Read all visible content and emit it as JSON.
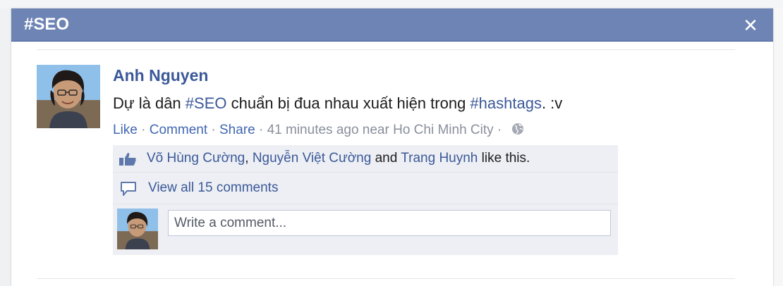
{
  "dialog": {
    "title": "#SEO",
    "close_label": "✕"
  },
  "post": {
    "author": "Anh Nguyen",
    "message": {
      "part1": "Dự là dân ",
      "hashtag1": "#SEO",
      "part2": " chuẩn bị đua nhau xuất hiện trong ",
      "hashtag2": "#hashtags",
      "part3": ". :v"
    },
    "actions": {
      "like": "Like",
      "comment": "Comment",
      "share": "Share",
      "separator": " · ",
      "timestamp": "41 minutes ago near Ho Chi Minh City",
      "privacy_icon": "globe-icon"
    }
  },
  "ufi": {
    "likers": [
      "Võ Hùng Cường",
      "Nguyễn Việt Cường",
      "Trang Huynh"
    ],
    "likes_comma": ", ",
    "likes_and": " and ",
    "likes_suffix": " like this.",
    "view_all_comments": "View all 15 comments",
    "comment_placeholder": "Write a comment..."
  },
  "colors": {
    "titlebar": "#6d84b4",
    "link": "#3b5998",
    "muted": "#898f9c",
    "ufi_background": "#edeff4"
  }
}
